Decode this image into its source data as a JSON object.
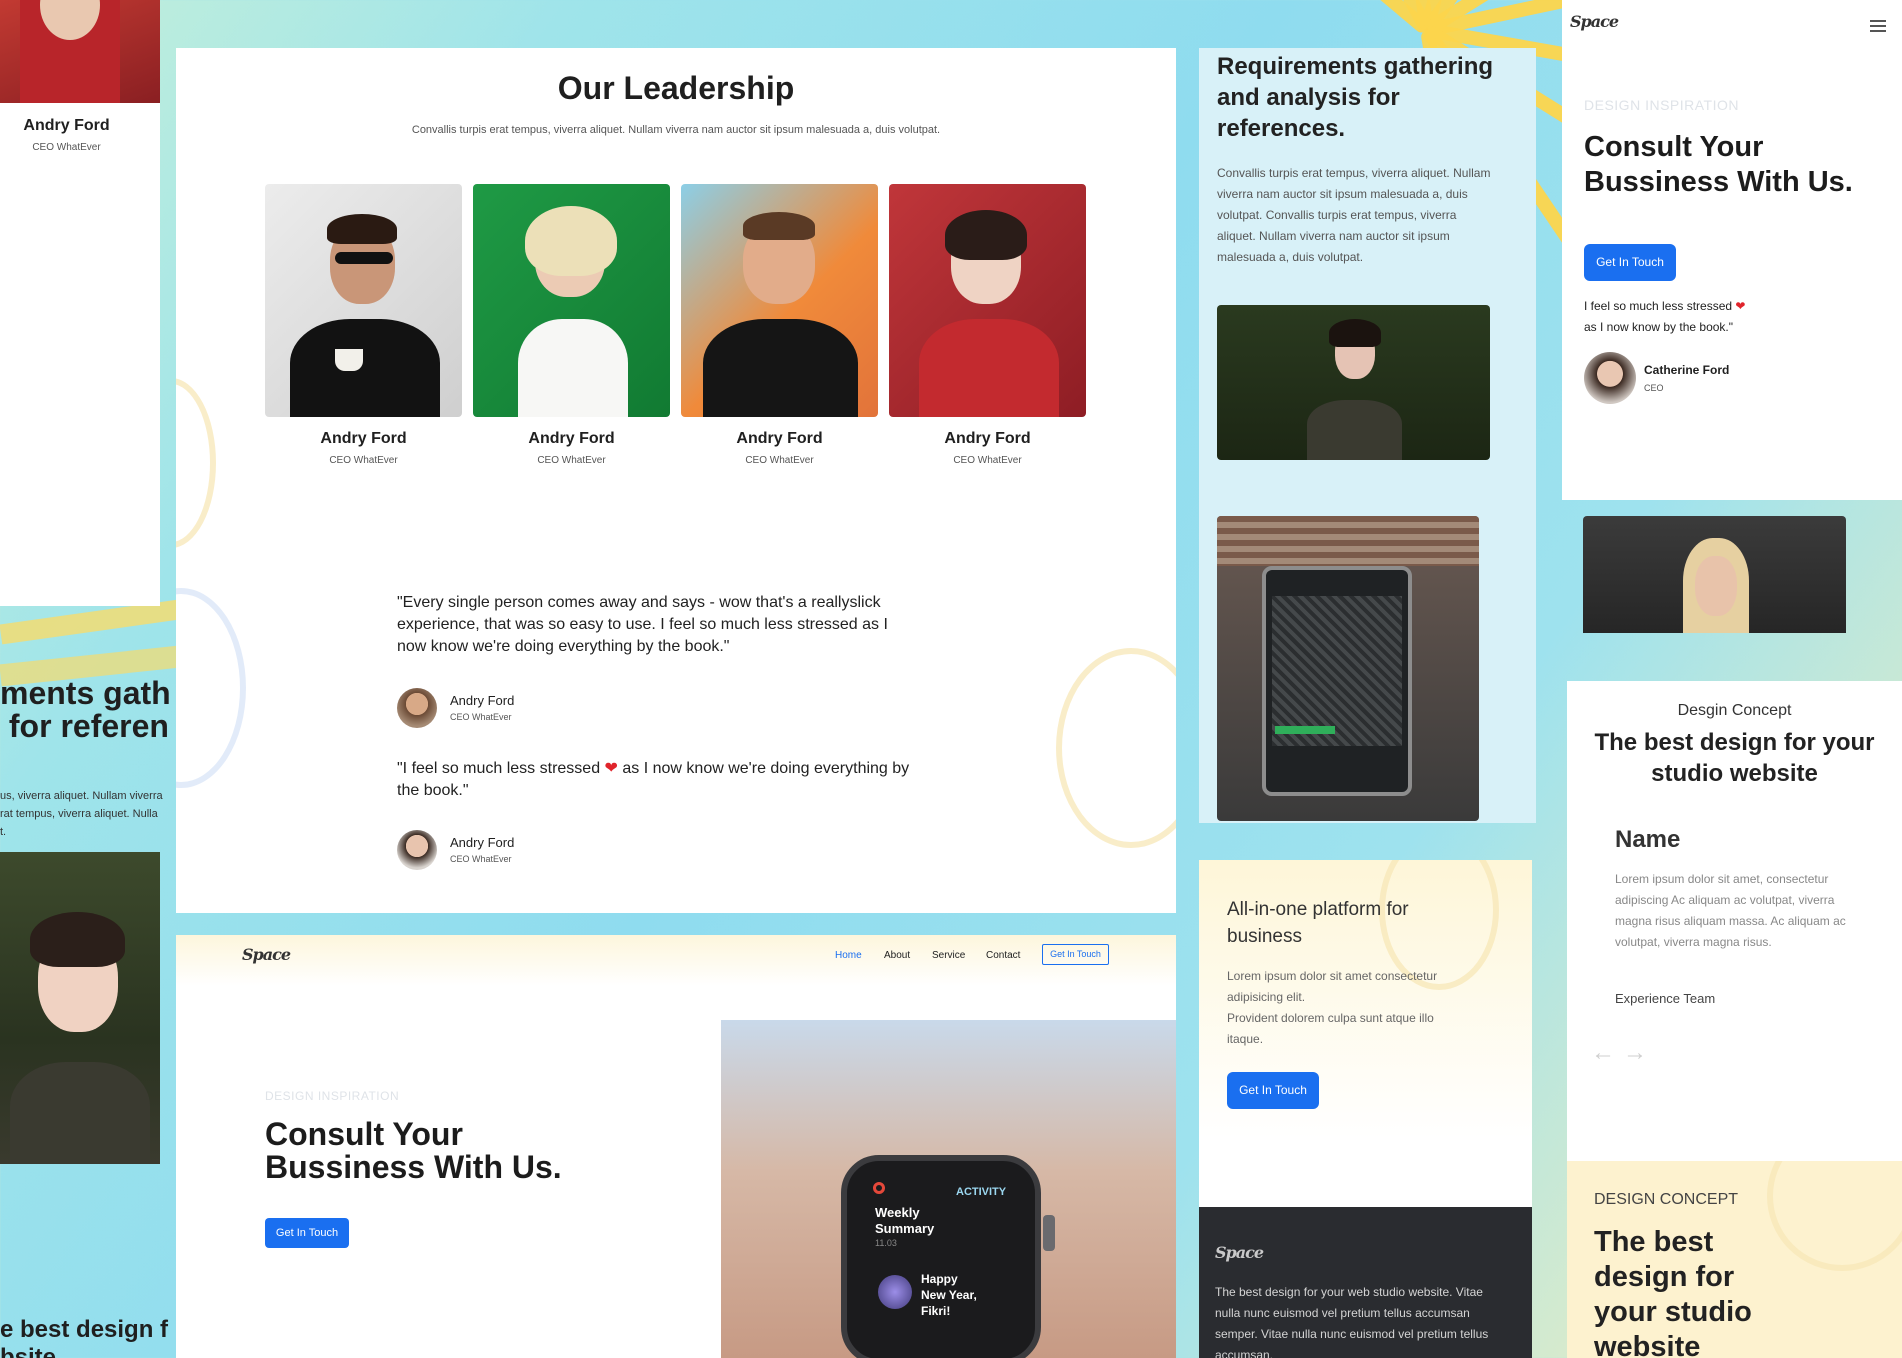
{
  "leftcol": {
    "name": "Andry Ford",
    "role": "CEO WhatEver",
    "heading_line1": "ments gath",
    "heading_line2": " for referen",
    "text_line1": "us, viverra aliquet. Nullam viverra",
    "text_line2": "rat tempus, viverra aliquet. Nulla",
    "text_line3": "t.",
    "bottom_line1": "e best design f",
    "bottom_line2": "bsite"
  },
  "leadership": {
    "title": "Our Leadership",
    "subtitle": "Convallis turpis erat tempus, viverra aliquet. Nullam viverra nam auctor sit ipsum malesuada a, duis volutpat.",
    "members": [
      {
        "name": "Andry Ford",
        "role": "CEO WhatEver"
      },
      {
        "name": "Andry Ford",
        "role": "CEO WhatEver"
      },
      {
        "name": "Andry Ford",
        "role": "CEO WhatEver"
      },
      {
        "name": "Andry Ford",
        "role": "CEO WhatEver"
      }
    ],
    "quote1": "\"Every single person comes away and says - wow that's a reallyslick experience, that was so easy to use. I feel so much less stressed as I now know we're doing everything by the book.\"",
    "quote1_author": "Andry Ford",
    "quote1_role": "CEO WhatEver",
    "quote2_part1": "\"I feel so much less stressed ",
    "quote2_heart": "❤",
    "quote2_part2": " as I now know we're doing everything by the book.\"",
    "quote2_author": "Andry Ford",
    "quote2_role": "CEO WhatEver"
  },
  "landing": {
    "logo": "Space",
    "nav": [
      "Home",
      "About",
      "Service",
      "Contact"
    ],
    "nav_cta": "Get In Touch",
    "eyebrow": "DESIGN INSPIRATION",
    "headline_line1": "Consult Your",
    "headline_line2": "Bussiness With Us.",
    "cta": "Get In Touch",
    "watch_activity": "ACTIVITY",
    "watch_weekly": "Weekly",
    "watch_summary": "Summary",
    "watch_date": "11.03",
    "watch_happy": "Happy",
    "watch_newyear": "New Year,",
    "watch_name": "Fikri!"
  },
  "requirements": {
    "heading": "Requirements gathering and analysis for references.",
    "body": "Convallis turpis erat tempus, viverra aliquet. Nullam viverra nam auctor sit ipsum malesuada a, duis volutpat. Convallis turpis erat tempus, viverra aliquet. Nullam viverra nam auctor sit ipsum malesuada a, duis volutpat."
  },
  "platform": {
    "heading": "All-in-one platform for business",
    "body1": "Lorem ipsum dolor sit amet consectetur adipisicing elit.",
    "body2": "Provident dolorem culpa sunt atque illo itaque.",
    "cta": "Get In Touch"
  },
  "footer": {
    "logo": "Space",
    "text": "The best design for your web studio website. Vitae nulla nunc euismod vel pretium tellus accumsan semper. Vitae nulla nunc euismod vel pretium tellus accumsan."
  },
  "mobile": {
    "logo": "Space",
    "eyebrow": "DESIGN INSPIRATION",
    "headline_line1": "Consult Your",
    "headline_line2": "Bussiness With Us.",
    "cta": "Get In Touch",
    "quote_part1": "I feel so much less stressed ",
    "quote_heart": "❤",
    "quote_line2": "as I now know by the book.\"",
    "person_name": "Catherine Ford",
    "person_role": "CEO"
  },
  "concept": {
    "eyebrow": "Desgin Concept",
    "heading": "The best design for your studio website",
    "name_title": "Name",
    "body": "Lorem ipsum dolor sit amet, consectetur adipiscing Ac aliquam ac volutpat, viverra magna risus aliquam massa. Ac aliquam ac volutpat, viverra magna risus.",
    "team": "Experience Team",
    "prev_arrow": "←",
    "next_arrow": "→"
  },
  "concept2": {
    "eyebrow": "DESIGN CONCEPT",
    "line1": "The best",
    "line2": "design for",
    "line3": "your studio",
    "line4": "website"
  },
  "colors": {
    "accent": "#1a6ff0",
    "heart": "#e0242b",
    "dark_footer": "#2a2c30",
    "cream": "#fdf2cf"
  }
}
